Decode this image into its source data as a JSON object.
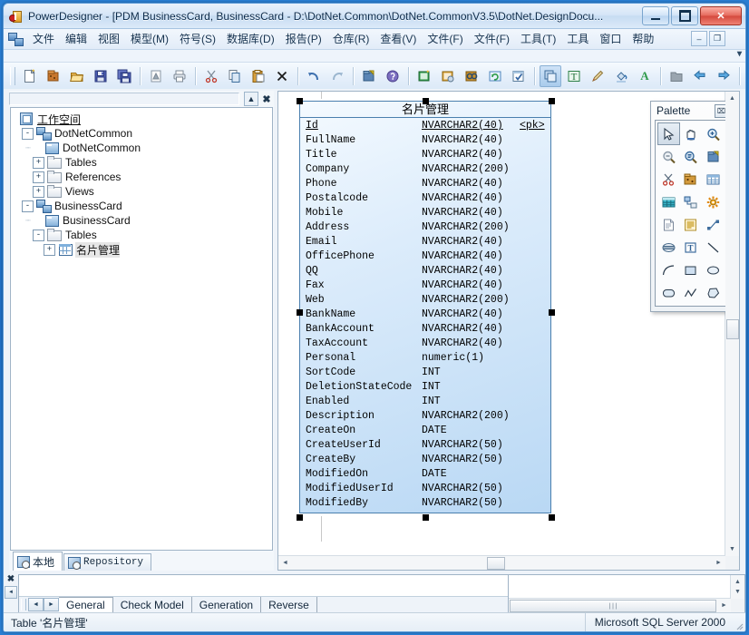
{
  "window": {
    "title": "PowerDesigner - [PDM BusinessCard, BusinessCard - D:\\DotNet.Common\\DotNet.CommonV3.5\\DotNet.DesignDocu...",
    "minimize_label": "–",
    "maximize_label": "□",
    "close_label": "✕"
  },
  "menubar": {
    "items": [
      {
        "label": "文件"
      },
      {
        "label": "编辑"
      },
      {
        "label": "视图"
      },
      {
        "label": "模型(M)"
      },
      {
        "label": "符号(S)"
      },
      {
        "label": "数据库(D)"
      },
      {
        "label": "报告(P)"
      },
      {
        "label": "仓库(R)"
      },
      {
        "label": "查看(V)"
      },
      {
        "label": "文件(F)"
      },
      {
        "label": "文件(F)"
      },
      {
        "label": "工具(T)"
      },
      {
        "label": "工具"
      },
      {
        "label": "窗口"
      },
      {
        "label": "帮助"
      }
    ],
    "mdi_restore": "–",
    "mdi_maximize": "❐",
    "overflow": "▾",
    "close_row": "✕"
  },
  "toolbar": {
    "groups": [
      [
        "new-document-icon",
        "open-model-icon",
        "open-folder-icon",
        "save-icon",
        "save-all-icon"
      ],
      [
        "print-preview-icon",
        "print-icon"
      ],
      [
        "cut-icon",
        "copy-icon",
        "paste-icon",
        "delete-icon"
      ],
      [
        "undo-icon",
        "redo-icon"
      ],
      [
        "properties-icon",
        "help-icon"
      ],
      [
        "new-diagram-icon",
        "model-properties-icon",
        "find-object-icon",
        "refresh-icon",
        "check-model-icon"
      ],
      [
        "select-tool-icon",
        "text-format-icon",
        "pencil-icon",
        "fill-color-icon",
        "font-color-icon"
      ],
      [
        "grey-folder-icon",
        "back-icon",
        "forward-icon"
      ],
      [
        "view-dependency-icon",
        "view-diagram-icon",
        "view-page-icon",
        "view-list-icon"
      ]
    ]
  },
  "left_panel": {
    "header": {
      "collapse_label": "▲",
      "close_label": "✖"
    },
    "tree": [
      {
        "level": 0,
        "label": "工作空间",
        "icon": "workspace-icon",
        "expander": "none",
        "underline": true
      },
      {
        "level": 1,
        "label": "DotNetCommon",
        "icon": "model-icon",
        "expander": "-"
      },
      {
        "level": 2,
        "label": "DotNetCommon",
        "icon": "diagram-icon",
        "expander": "none"
      },
      {
        "level": 2,
        "label": "Tables",
        "icon": "folder-icon",
        "expander": "+"
      },
      {
        "level": 2,
        "label": "References",
        "icon": "folder-icon",
        "expander": "+"
      },
      {
        "level": 2,
        "label": "Views",
        "icon": "folder-icon",
        "expander": "+"
      },
      {
        "level": 1,
        "label": "BusinessCard",
        "icon": "model-icon",
        "expander": "-"
      },
      {
        "level": 2,
        "label": "BusinessCard",
        "icon": "diagram-icon",
        "expander": "none"
      },
      {
        "level": 2,
        "label": "Tables",
        "icon": "folder-icon",
        "expander": "-"
      },
      {
        "level": 3,
        "label": "名片管理",
        "icon": "table-icon",
        "expander": "+",
        "selected": true
      }
    ],
    "tabs": [
      {
        "label": "本地",
        "active": true,
        "icon": "local-icon"
      },
      {
        "label": "Repository",
        "active": false,
        "icon": "repository-icon"
      }
    ]
  },
  "diagram": {
    "entity": {
      "title": "名片管理",
      "columns": [
        {
          "name": "Id",
          "type": "NVARCHAR2(40)",
          "key": "<pk>",
          "pk": true
        },
        {
          "name": "FullName",
          "type": "NVARCHAR2(40)",
          "key": "",
          "pk": false
        },
        {
          "name": "Title",
          "type": "NVARCHAR2(40)",
          "key": "",
          "pk": false
        },
        {
          "name": "Company",
          "type": "NVARCHAR2(200)",
          "key": "",
          "pk": false
        },
        {
          "name": "Phone",
          "type": "NVARCHAR2(40)",
          "key": "",
          "pk": false
        },
        {
          "name": "Postalcode",
          "type": "NVARCHAR2(40)",
          "key": "",
          "pk": false
        },
        {
          "name": "Mobile",
          "type": "NVARCHAR2(40)",
          "key": "",
          "pk": false
        },
        {
          "name": "Address",
          "type": "NVARCHAR2(200)",
          "key": "",
          "pk": false
        },
        {
          "name": "Email",
          "type": "NVARCHAR2(40)",
          "key": "",
          "pk": false
        },
        {
          "name": "OfficePhone",
          "type": "NVARCHAR2(40)",
          "key": "",
          "pk": false
        },
        {
          "name": "QQ",
          "type": "NVARCHAR2(40)",
          "key": "",
          "pk": false
        },
        {
          "name": "Fax",
          "type": "NVARCHAR2(40)",
          "key": "",
          "pk": false
        },
        {
          "name": "Web",
          "type": "NVARCHAR2(200)",
          "key": "",
          "pk": false
        },
        {
          "name": "BankName",
          "type": "NVARCHAR2(40)",
          "key": "",
          "pk": false
        },
        {
          "name": "BankAccount",
          "type": "NVARCHAR2(40)",
          "key": "",
          "pk": false
        },
        {
          "name": "TaxAccount",
          "type": "NVARCHAR2(40)",
          "key": "",
          "pk": false
        },
        {
          "name": "Personal",
          "type": "numeric(1)",
          "key": "",
          "pk": false
        },
        {
          "name": "SortCode",
          "type": "INT",
          "key": "",
          "pk": false
        },
        {
          "name": "DeletionStateCode",
          "type": "INT",
          "key": "",
          "pk": false
        },
        {
          "name": "Enabled",
          "type": "INT",
          "key": "",
          "pk": false
        },
        {
          "name": "Description",
          "type": "NVARCHAR2(200)",
          "key": "",
          "pk": false
        },
        {
          "name": "CreateOn",
          "type": "DATE",
          "key": "",
          "pk": false
        },
        {
          "name": "CreateUserId",
          "type": "NVARCHAR2(50)",
          "key": "",
          "pk": false
        },
        {
          "name": "CreateBy",
          "type": "NVARCHAR2(50)",
          "key": "",
          "pk": false
        },
        {
          "name": "ModifiedOn",
          "type": "DATE",
          "key": "",
          "pk": false
        },
        {
          "name": "ModifiedUserId",
          "type": "NVARCHAR2(50)",
          "key": "",
          "pk": false
        },
        {
          "name": "ModifiedBy",
          "type": "NVARCHAR2(50)",
          "key": "",
          "pk": false
        }
      ]
    },
    "scroll": {
      "up": "▲",
      "down": "▼",
      "left": "◄",
      "right": "►"
    }
  },
  "palette": {
    "title": "Palette",
    "close_label": "⌧",
    "tools": [
      {
        "name": "pointer-tool-icon",
        "selected": true
      },
      {
        "name": "grabber-hand-tool-icon",
        "selected": false
      },
      {
        "name": "zoom-in-tool-icon",
        "selected": false
      },
      {
        "name": "zoom-out-tool-icon",
        "selected": false
      },
      {
        "name": "zoom-page-tool-icon",
        "selected": false
      },
      {
        "name": "properties-tool-icon",
        "selected": false
      },
      {
        "name": "delete-scissors-tool-icon",
        "selected": false
      },
      {
        "name": "package-tool-icon",
        "selected": false
      },
      {
        "name": "table-tool-icon",
        "selected": false
      },
      {
        "name": "view-tool-icon",
        "selected": false
      },
      {
        "name": "reference-tool-icon",
        "selected": false
      },
      {
        "name": "procedure-tool-icon",
        "selected": false
      },
      {
        "name": "file-tool-icon",
        "selected": false
      },
      {
        "name": "note-tool-icon",
        "selected": false
      },
      {
        "name": "link-tool-icon",
        "selected": false
      },
      {
        "name": "title-tool-icon",
        "selected": false
      },
      {
        "name": "text-tool-icon",
        "selected": false
      },
      {
        "name": "line-tool-icon",
        "selected": false
      },
      {
        "name": "arc-tool-icon",
        "selected": false
      },
      {
        "name": "rectangle-tool-icon",
        "selected": false
      },
      {
        "name": "ellipse-tool-icon",
        "selected": false
      },
      {
        "name": "rounded-rect-tool-icon",
        "selected": false
      },
      {
        "name": "polyline-tool-icon",
        "selected": false
      },
      {
        "name": "polygon-tool-icon",
        "selected": false
      }
    ]
  },
  "output": {
    "close_label": "✖",
    "scroll_up": "▲",
    "nav_prev": "◄",
    "nav_next": "►",
    "tabs": [
      {
        "label": "General",
        "active": true
      },
      {
        "label": "Check Model",
        "active": false
      },
      {
        "label": "Generation",
        "active": false
      },
      {
        "label": "Reverse",
        "active": false
      }
    ],
    "right_scroll": {
      "up": "▲",
      "down": "▼",
      "left": "◄",
      "right": "►",
      "grip": "∣∣∣"
    }
  },
  "statusbar": {
    "left": "Table '名片管理'",
    "right": "Microsoft SQL Server 2000"
  }
}
